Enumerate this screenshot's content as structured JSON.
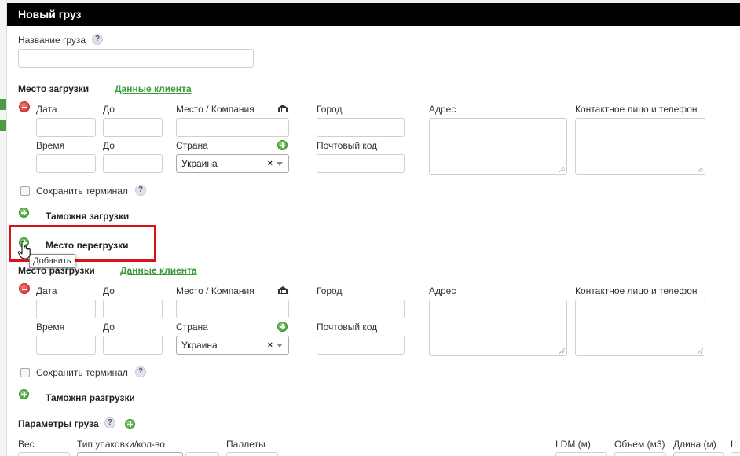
{
  "window": {
    "title": "Новый груз"
  },
  "cargo_name": {
    "label": "Название груза",
    "help": "?",
    "value": ""
  },
  "loading": {
    "title": "Место загрузки",
    "client_link": "Данные клиента",
    "labels": {
      "date": "Дата",
      "to": "До",
      "place": "Место / Компания",
      "city": "Город",
      "address": "Адрес",
      "contact": "Контактное лицо и телефон",
      "time": "Время",
      "to2": "До",
      "country": "Страна",
      "postal": "Почтовый код"
    },
    "country_value": "Украина",
    "clear_symbol": "×",
    "save_terminal": "Сохранить терминал",
    "help": "?",
    "customs": "Таможня загрузки"
  },
  "transshipment": {
    "label": "Место перегрузки",
    "tooltip": "Добавить"
  },
  "unloading": {
    "title": "Место разгрузки",
    "client_link": "Данные клиента",
    "labels": {
      "date": "Дата",
      "to": "До",
      "place": "Место / Компания",
      "city": "Город",
      "address": "Адрес",
      "contact": "Контактное лицо и телефон",
      "time": "Время",
      "to2": "До",
      "country": "Страна",
      "postal": "Почтовый код"
    },
    "country_value": "Украина",
    "clear_symbol": "×",
    "save_terminal": "Сохранить терминал",
    "help": "?",
    "customs": "Таможня разгрузки"
  },
  "cargo_params": {
    "title": "Параметры груза",
    "help": "?",
    "cols": {
      "weight": "Вес",
      "packaging": "Тип упаковки/кол-во",
      "pallets": "Паллеты",
      "ldm": "LDM (м)",
      "volume": "Объем (м3)",
      "length": "Длина (м)",
      "width_partial": "Ш"
    }
  },
  "colors": {
    "accent_link": "#3d9a3d",
    "highlight": "#d8141a",
    "titlebar": "#000000"
  }
}
